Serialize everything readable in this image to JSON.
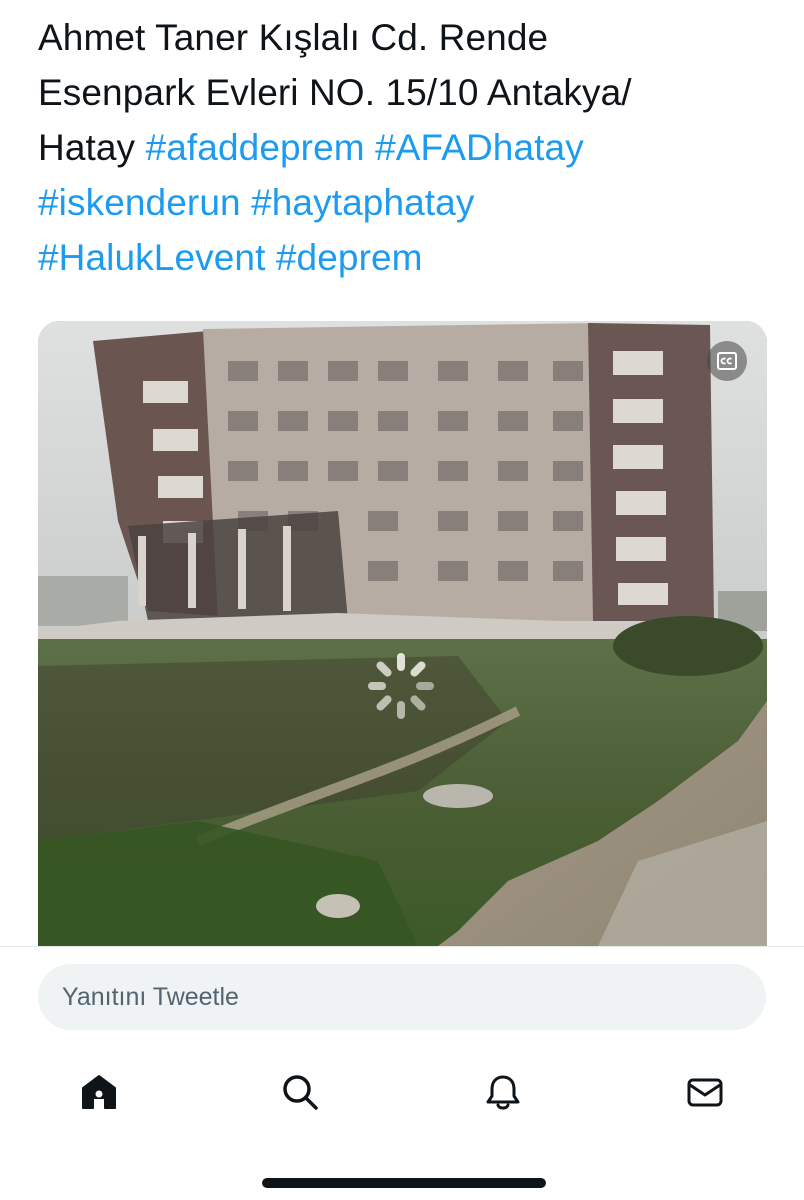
{
  "tweet": {
    "text_line1": "Ahmet Taner Kışlalı Cd. Rende",
    "text_line2": "Esenpark Evleri NO. 15/10 Antakya/",
    "text_line3_plain": "Hatay",
    "hashtags": [
      "#afaddeprem",
      "#AFADhatay",
      "#iskenderun",
      "#haytaphatay",
      "#HalukLevent",
      "#deprem"
    ]
  },
  "media": {
    "alt": "Video of a partially collapsed apartment building after earthquake",
    "cc_icon": "closed-captions-icon",
    "loading_icon": "loading-spinner-icon"
  },
  "reply": {
    "placeholder": "Yanıtını Tweetle"
  },
  "nav": {
    "icons": [
      "home-icon",
      "search-icon",
      "notifications-icon",
      "messages-icon"
    ]
  },
  "colors": {
    "text": "#0f1419",
    "hashtag": "#1d9bf0",
    "reply_bg": "#eff3f4",
    "muted": "#536471"
  }
}
